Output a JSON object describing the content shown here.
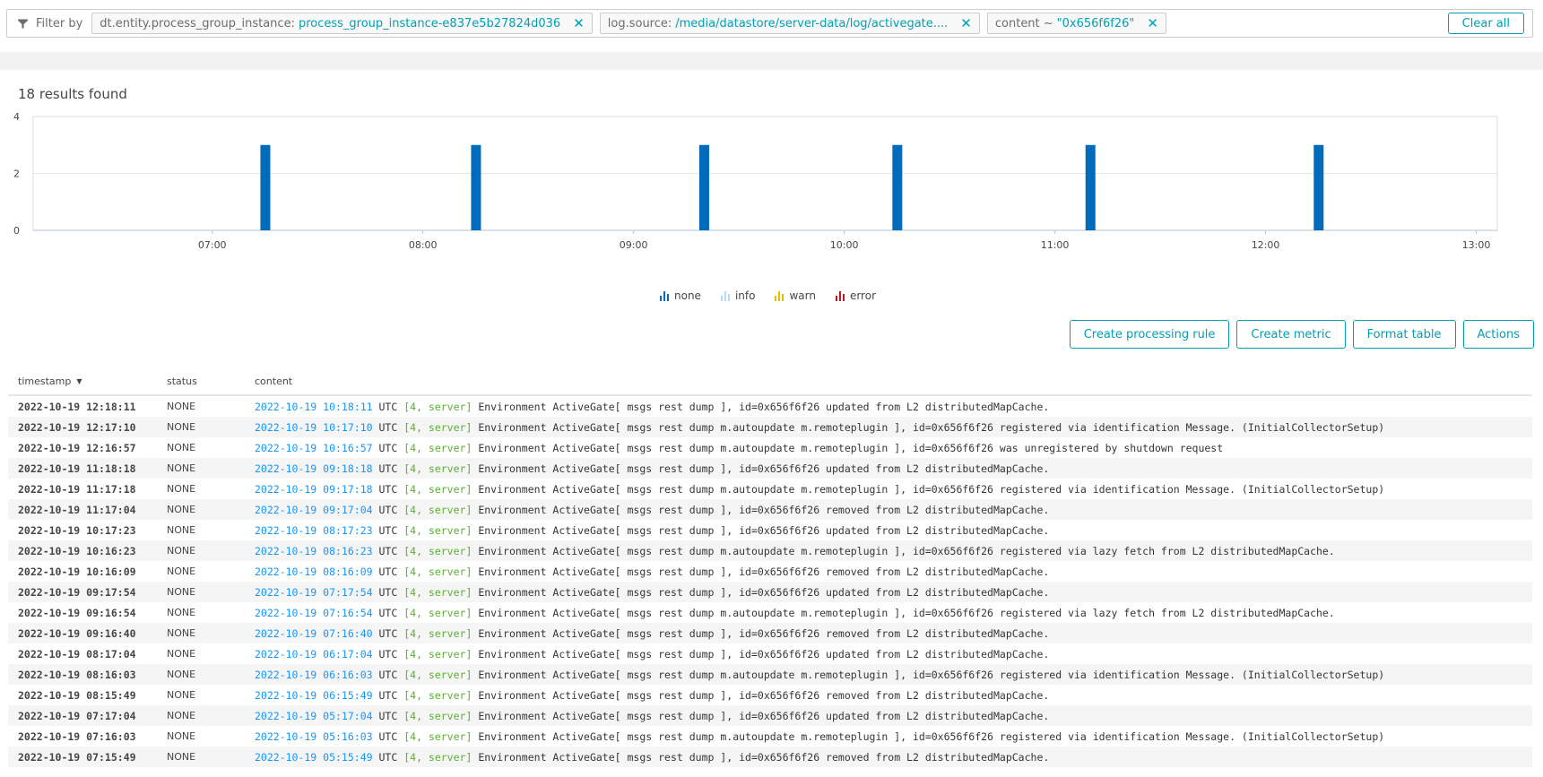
{
  "filter_bar": {
    "label": "Filter by",
    "chips": [
      {
        "key": "dt.entity.process_group_instance:",
        "value": "process_group_instance-e837e5b27824d036"
      },
      {
        "key": "log.source:",
        "value": "/media/datastore/server-data/log/activegate...."
      },
      {
        "key": "content ~",
        "value": "\"0x656f6f26\""
      }
    ],
    "clear_all_label": "Clear all",
    "close_glyph": "✕"
  },
  "results": {
    "count_label": "18 results found"
  },
  "chart_data": {
    "type": "bar",
    "title": "",
    "xlabel": "",
    "ylabel": "",
    "ylim": [
      0,
      4
    ],
    "yticks": [
      0,
      2,
      4
    ],
    "xlim_hours": [
      6.15,
      13.1
    ],
    "xticks": [
      "07:00",
      "08:00",
      "09:00",
      "10:00",
      "11:00",
      "12:00",
      "13:00"
    ],
    "grid": true,
    "legend_position": "bottom-center",
    "series": [
      {
        "name": "none",
        "color": "#006bba",
        "points": [
          {
            "x": "07:15",
            "y": 3
          },
          {
            "x": "08:15",
            "y": 3
          },
          {
            "x": "09:20",
            "y": 3
          },
          {
            "x": "10:15",
            "y": 3
          },
          {
            "x": "11:10",
            "y": 3
          },
          {
            "x": "12:15",
            "y": 3
          }
        ]
      },
      {
        "name": "info",
        "color": "#b4dcf8",
        "points": []
      },
      {
        "name": "warn",
        "color": "#e6be00",
        "points": []
      },
      {
        "name": "error",
        "color": "#c41425",
        "points": []
      }
    ]
  },
  "toolbar": {
    "create_processing_rule": "Create processing rule",
    "create_metric": "Create metric",
    "format_table": "Format table",
    "actions": "Actions"
  },
  "table": {
    "columns": {
      "timestamp": "timestamp",
      "status": "status",
      "content": "content"
    },
    "sort_glyph": "▼",
    "rows": [
      {
        "timestamp": "2022-10-19 12:18:11",
        "status": "NONE",
        "date": "2022-10-19 10:18:11",
        "utc": "UTC",
        "thread": "[4, server]",
        "message": "Environment ActiveGate[ msgs rest dump ], id=0x656f6f26 updated from L2 distributedMapCache."
      },
      {
        "timestamp": "2022-10-19 12:17:10",
        "status": "NONE",
        "date": "2022-10-19 10:17:10",
        "utc": "UTC",
        "thread": "[4, server]",
        "message": "Environment ActiveGate[ msgs rest dump m.autoupdate m.remoteplugin ], id=0x656f6f26 registered via identification Message. (InitialCollectorSetup)"
      },
      {
        "timestamp": "2022-10-19 12:16:57",
        "status": "NONE",
        "date": "2022-10-19 10:16:57",
        "utc": "UTC",
        "thread": "[4, server]",
        "message": "Environment ActiveGate[ msgs rest dump m.autoupdate m.remoteplugin ], id=0x656f6f26 was unregistered by shutdown request"
      },
      {
        "timestamp": "2022-10-19 11:18:18",
        "status": "NONE",
        "date": "2022-10-19 09:18:18",
        "utc": "UTC",
        "thread": "[4, server]",
        "message": "Environment ActiveGate[ msgs rest dump ], id=0x656f6f26 updated from L2 distributedMapCache."
      },
      {
        "timestamp": "2022-10-19 11:17:18",
        "status": "NONE",
        "date": "2022-10-19 09:17:18",
        "utc": "UTC",
        "thread": "[4, server]",
        "message": "Environment ActiveGate[ msgs rest dump m.autoupdate m.remoteplugin ], id=0x656f6f26 registered via identification Message. (InitialCollectorSetup)"
      },
      {
        "timestamp": "2022-10-19 11:17:04",
        "status": "NONE",
        "date": "2022-10-19 09:17:04",
        "utc": "UTC",
        "thread": "[4, server]",
        "message": "Environment ActiveGate[ msgs rest dump ], id=0x656f6f26 removed from L2 distributedMapCache."
      },
      {
        "timestamp": "2022-10-19 10:17:23",
        "status": "NONE",
        "date": "2022-10-19 08:17:23",
        "utc": "UTC",
        "thread": "[4, server]",
        "message": "Environment ActiveGate[ msgs rest dump ], id=0x656f6f26 updated from L2 distributedMapCache."
      },
      {
        "timestamp": "2022-10-19 10:16:23",
        "status": "NONE",
        "date": "2022-10-19 08:16:23",
        "utc": "UTC",
        "thread": "[4, server]",
        "message": "Environment ActiveGate[ msgs rest dump m.autoupdate m.remoteplugin ], id=0x656f6f26 registered via lazy fetch from L2 distributedMapCache."
      },
      {
        "timestamp": "2022-10-19 10:16:09",
        "status": "NONE",
        "date": "2022-10-19 08:16:09",
        "utc": "UTC",
        "thread": "[4, server]",
        "message": "Environment ActiveGate[ msgs rest dump ], id=0x656f6f26 removed from L2 distributedMapCache."
      },
      {
        "timestamp": "2022-10-19 09:17:54",
        "status": "NONE",
        "date": "2022-10-19 07:17:54",
        "utc": "UTC",
        "thread": "[4, server]",
        "message": "Environment ActiveGate[ msgs rest dump ], id=0x656f6f26 updated from L2 distributedMapCache."
      },
      {
        "timestamp": "2022-10-19 09:16:54",
        "status": "NONE",
        "date": "2022-10-19 07:16:54",
        "utc": "UTC",
        "thread": "[4, server]",
        "message": "Environment ActiveGate[ msgs rest dump m.autoupdate m.remoteplugin ], id=0x656f6f26 registered via lazy fetch from L2 distributedMapCache."
      },
      {
        "timestamp": "2022-10-19 09:16:40",
        "status": "NONE",
        "date": "2022-10-19 07:16:40",
        "utc": "UTC",
        "thread": "[4, server]",
        "message": "Environment ActiveGate[ msgs rest dump ], id=0x656f6f26 removed from L2 distributedMapCache."
      },
      {
        "timestamp": "2022-10-19 08:17:04",
        "status": "NONE",
        "date": "2022-10-19 06:17:04",
        "utc": "UTC",
        "thread": "[4, server]",
        "message": "Environment ActiveGate[ msgs rest dump ], id=0x656f6f26 updated from L2 distributedMapCache."
      },
      {
        "timestamp": "2022-10-19 08:16:03",
        "status": "NONE",
        "date": "2022-10-19 06:16:03",
        "utc": "UTC",
        "thread": "[4, server]",
        "message": "Environment ActiveGate[ msgs rest dump m.autoupdate m.remoteplugin ], id=0x656f6f26 registered via identification Message. (InitialCollectorSetup)"
      },
      {
        "timestamp": "2022-10-19 08:15:49",
        "status": "NONE",
        "date": "2022-10-19 06:15:49",
        "utc": "UTC",
        "thread": "[4, server]",
        "message": "Environment ActiveGate[ msgs rest dump ], id=0x656f6f26 removed from L2 distributedMapCache."
      },
      {
        "timestamp": "2022-10-19 07:17:04",
        "status": "NONE",
        "date": "2022-10-19 05:17:04",
        "utc": "UTC",
        "thread": "[4, server]",
        "message": "Environment ActiveGate[ msgs rest dump ], id=0x656f6f26 updated from L2 distributedMapCache."
      },
      {
        "timestamp": "2022-10-19 07:16:03",
        "status": "NONE",
        "date": "2022-10-19 05:16:03",
        "utc": "UTC",
        "thread": "[4, server]",
        "message": "Environment ActiveGate[ msgs rest dump m.autoupdate m.remoteplugin ], id=0x656f6f26 registered via identification Message. (InitialCollectorSetup)"
      },
      {
        "timestamp": "2022-10-19 07:15:49",
        "status": "NONE",
        "date": "2022-10-19 05:15:49",
        "utc": "UTC",
        "thread": "[4, server]",
        "message": "Environment ActiveGate[ msgs rest dump ], id=0x656f6f26 removed from L2 distributedMapCache."
      }
    ]
  }
}
